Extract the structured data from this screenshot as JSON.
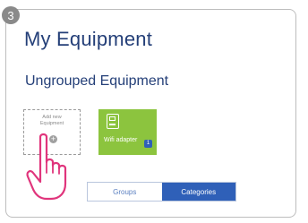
{
  "step_badge": "3",
  "header": {
    "title": "My Equipment"
  },
  "section": {
    "title": "Ungrouped Equipment"
  },
  "tiles": {
    "add": {
      "label": "Add new Equipment",
      "icon": "plus-icon",
      "plus_glyph": "+"
    },
    "equipment": {
      "name": "Wifi adapter",
      "count": "1",
      "icon": "device-icon",
      "color": "#8cc43e"
    }
  },
  "toggle": {
    "groups_label": "Groups",
    "categories_label": "Categories",
    "selected": "Categories",
    "accent": "#2f60b8"
  },
  "cursor": {
    "icon": "pointing-hand-icon",
    "color": "#e0357c"
  }
}
